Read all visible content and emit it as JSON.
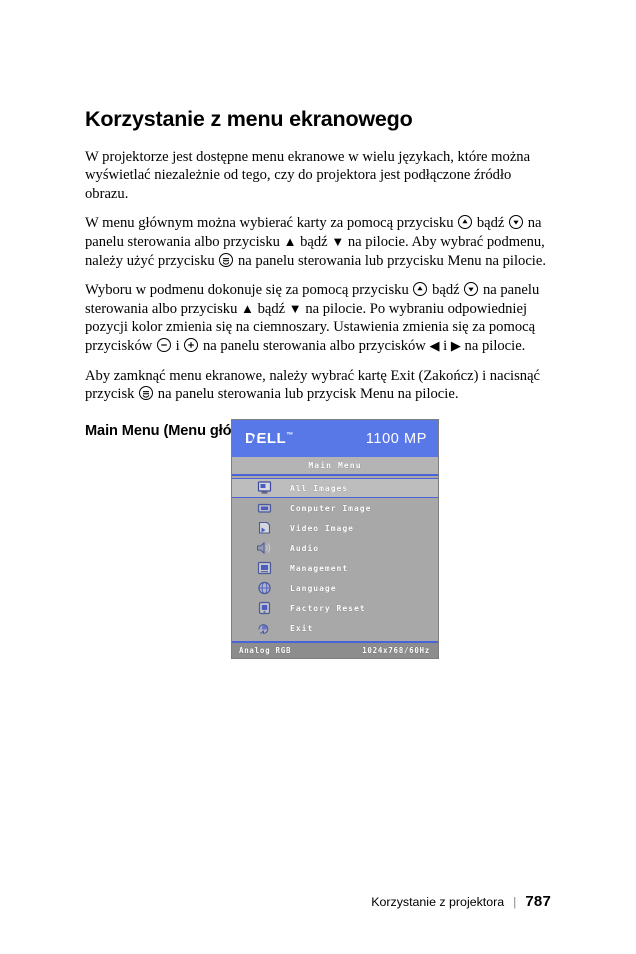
{
  "document": {
    "title": "Korzystanie z menu ekranowego",
    "paragraphs": {
      "p1": "W projektorze jest dostępne menu ekranowe w wielu językach, które można wyświetlać niezależnie od tego, czy do projektora jest podłączone źródło obrazu.",
      "p2a": "W menu głównym można wybierać karty za pomocą przycisku",
      "p2b": "bądź",
      "p2c": "na panelu sterowania albo przycisku",
      "p2d": "bądź",
      "p2e": "na pilocie. Aby wybrać podmenu, należy użyć przycisku",
      "p2f": "na panelu sterowania lub przycisku Menu na pilocie.",
      "p3a": "Wyboru w podmenu dokonuje się za pomocą przycisku",
      "p3b": "bądź",
      "p3c": "na panelu sterowania albo przycisku",
      "p3d": "bądź",
      "p3e": "na pilocie. Po wybraniu odpowiedniej pozycji kolor zmienia się na ciemnoszary. Ustawienia zmienia się za pomocą przycisków",
      "p3f": "i",
      "p3g": "na panelu sterowania albo przycisków",
      "p3h": "i",
      "p3i": "na pilocie.",
      "p4a": "Aby zamknąć menu ekranowe, należy wybrać kartę Exit (Zakończ) i nacisnąć przycisk",
      "p4b": "na panelu sterowania lub przycisk Menu na pilocie."
    },
    "subheading": "Main Menu (Menu główne)",
    "arrow_up": "▲",
    "arrow_down": "▼",
    "arrow_left": "◀",
    "arrow_right": "▶"
  },
  "osd": {
    "brand": "D",
    "brand_rest": "LL",
    "brand_e": "E",
    "trademark": "™",
    "model": "1100 MP",
    "title": "Main Menu",
    "items": [
      {
        "label": "All Images",
        "icon": "all-images-icon",
        "selected": true
      },
      {
        "label": "Computer Image",
        "icon": "computer-image-icon",
        "selected": false
      },
      {
        "label": "Video Image",
        "icon": "video-image-icon",
        "selected": false
      },
      {
        "label": "Audio",
        "icon": "audio-icon",
        "selected": false
      },
      {
        "label": "Management",
        "icon": "management-icon",
        "selected": false
      },
      {
        "label": "Language",
        "icon": "language-icon",
        "selected": false
      },
      {
        "label": "Factory Reset",
        "icon": "factory-reset-icon",
        "selected": false
      },
      {
        "label": "Exit",
        "icon": "exit-icon",
        "selected": false
      }
    ],
    "status": {
      "source": "Analog RGB",
      "resolution": "1024x768/60Hz"
    },
    "colors": {
      "header_blue": "#5878e8",
      "accent_blue": "#4a64d8",
      "panel_gray": "#a8a8a8",
      "selected_gray": "#bdbdbd",
      "title_gray": "#b4b4b4",
      "status_gray": "#8d8d8d"
    }
  },
  "footer": {
    "section": "Korzystanie z projektora",
    "separator": "|",
    "page_number": "787"
  }
}
